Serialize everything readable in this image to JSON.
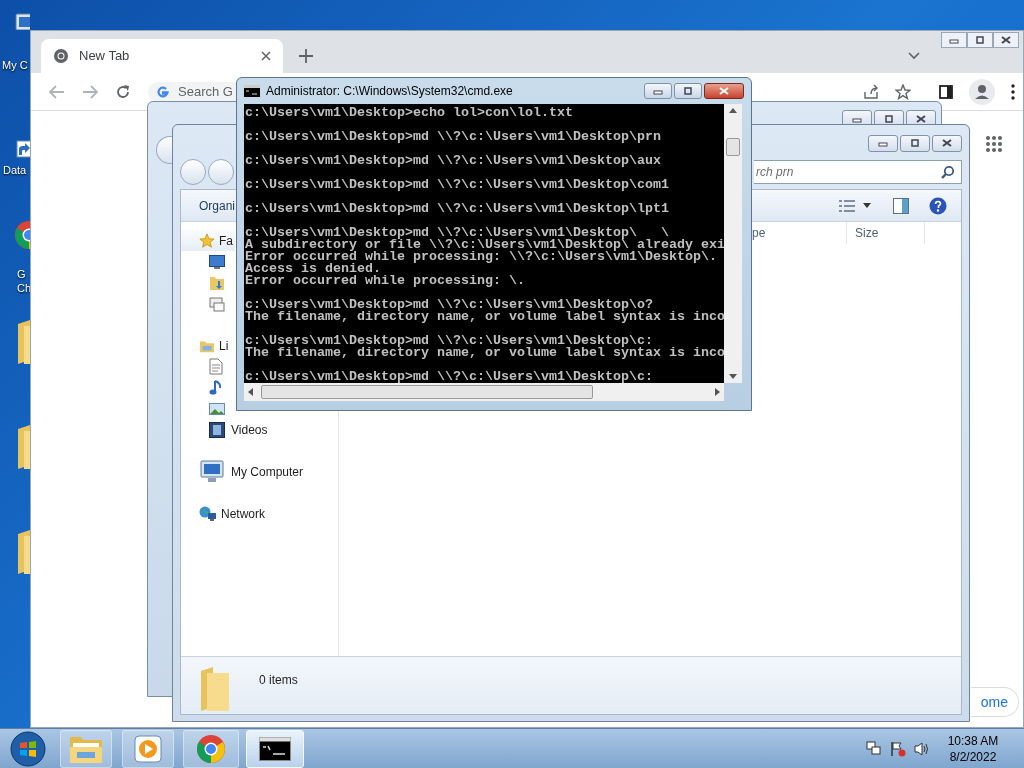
{
  "desktop": {
    "icons": [
      {
        "kind": "computer",
        "label": "My C"
      },
      {
        "kind": "shortcut",
        "label": "Data"
      },
      {
        "kind": "chrome",
        "label": "G Ch"
      },
      {
        "kind": "folder"
      },
      {
        "kind": "folder"
      },
      {
        "kind": "folder"
      }
    ]
  },
  "browser": {
    "tabs": [
      {
        "label": "New Tab",
        "selected": true
      }
    ],
    "omnibox": {
      "placeholder": "Search G"
    },
    "customize_button": "ome"
  },
  "explorer": {
    "search": {
      "placeholder": "rch prn"
    },
    "organize": "Organi",
    "columns": [
      "pe",
      "Size"
    ],
    "sidebar": [
      {
        "kind": "favorites",
        "label": "Fa",
        "children": [
          {
            "kind": "desktop"
          },
          {
            "kind": "downloads"
          },
          {
            "kind": "recent"
          }
        ]
      },
      {
        "kind": "libraries",
        "label": "Li",
        "children": [
          {
            "kind": "documents"
          },
          {
            "kind": "music"
          },
          {
            "kind": "pictures"
          },
          {
            "kind": "videos",
            "label": "Videos"
          }
        ]
      },
      {
        "kind": "computer",
        "label": "My Computer"
      },
      {
        "kind": "network",
        "label": "Network"
      }
    ],
    "status": "0 items"
  },
  "console": {
    "title": "Administrator: C:\\Windows\\System32\\cmd.exe",
    "blocks": [
      [
        "c:\\Users\\vm1\\Desktop>echo lol>con\\lol.txt"
      ],
      [
        "c:\\Users\\vm1\\Desktop>md \\\\?\\c:\\Users\\vm1\\Desktop\\prn"
      ],
      [
        "c:\\Users\\vm1\\Desktop>md \\\\?\\c:\\Users\\vm1\\Desktop\\aux"
      ],
      [
        "c:\\Users\\vm1\\Desktop>md \\\\?\\c:\\Users\\vm1\\Desktop\\com1"
      ],
      [
        "c:\\Users\\vm1\\Desktop>md \\\\?\\c:\\Users\\vm1\\Desktop\\lpt1"
      ],
      [
        "c:\\Users\\vm1\\Desktop>md \\\\?\\c:\\Users\\vm1\\Desktop\\   \\",
        "A subdirectory or file \\\\?\\c:\\Users\\vm1\\Desktop\\ already exi",
        "Error occurred while processing: \\\\?\\c:\\Users\\vm1\\Desktop\\.",
        "Access is denied.",
        "Error occurred while processing: \\."
      ],
      [
        "c:\\Users\\vm1\\Desktop>md \\\\?\\c:\\Users\\vm1\\Desktop\\o?",
        "The filename, directory name, or volume label syntax is inco"
      ],
      [
        "c:\\Users\\vm1\\Desktop>md \\\\?\\c:\\Users\\vm1\\Desktop\\c:",
        "The filename, directory name, or volume label syntax is inco"
      ],
      [
        "c:\\Users\\vm1\\Desktop>md \\\\?\\c:\\Users\\vm1\\Desktop\\c:"
      ]
    ]
  },
  "taskbar": {
    "buttons": [
      {
        "kind": "start",
        "selected": false
      },
      {
        "kind": "explorer",
        "selected": false
      },
      {
        "kind": "media",
        "selected": false
      },
      {
        "kind": "chrome",
        "selected": false
      },
      {
        "kind": "cmd",
        "selected": true
      }
    ],
    "clock": {
      "time": "10:38 AM",
      "date": "8/2/2022"
    }
  }
}
